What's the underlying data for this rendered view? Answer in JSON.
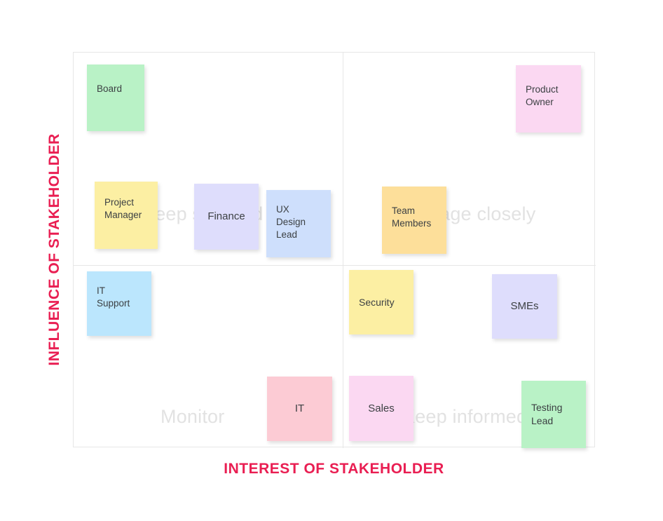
{
  "axes": {
    "y_title": "INFLUENCE OF STAKEHOLDER",
    "x_title": "INTEREST OF STAKEHOLDER",
    "axis_color": "#E91E52"
  },
  "matrix": {
    "frame_color": "#E6E6E6",
    "quadrants": [
      {
        "key": "keep_satisfied",
        "label": "Keep satisfied",
        "position": "top-left"
      },
      {
        "key": "manage_closely",
        "label": "Manage closely",
        "position": "top-right"
      },
      {
        "key": "monitor",
        "label": "Monitor",
        "position": "bottom-left"
      },
      {
        "key": "keep_informed",
        "label": "Keep informed",
        "position": "bottom-right"
      }
    ],
    "quadrant_label_color": "#E2E2E2"
  },
  "notes": [
    {
      "id": "board",
      "label": "Board",
      "color": "#B9F2C6",
      "quadrant": "keep_satisfied",
      "align": "left",
      "vertical": "top"
    },
    {
      "id": "project-manager",
      "label": "Project\nManager",
      "color": "#FCEFA3",
      "quadrant": "keep_satisfied",
      "align": "left",
      "vertical": "top"
    },
    {
      "id": "finance",
      "label": "Finance",
      "color": "#DEDDFC",
      "quadrant": "keep_satisfied",
      "align": "center",
      "vertical": "middle"
    },
    {
      "id": "ux-design-lead",
      "label": "UX\nDesign\nLead",
      "color": "#CEDFFC",
      "quadrant": "keep_satisfied",
      "align": "left",
      "vertical": "top"
    },
    {
      "id": "product-owner",
      "label": "Product\nOwner",
      "color": "#FBD8F2",
      "quadrant": "manage_closely",
      "align": "left",
      "vertical": "top"
    },
    {
      "id": "team-members",
      "label": "Team\nMembers",
      "color": "#FDDF9A",
      "quadrant": "manage_closely",
      "align": "left",
      "vertical": "top"
    },
    {
      "id": "it-support",
      "label": "IT\nSupport",
      "color": "#BBE6FD",
      "quadrant": "monitor",
      "align": "left",
      "vertical": "top"
    },
    {
      "id": "it",
      "label": "IT",
      "color": "#FCCBD4",
      "quadrant": "monitor",
      "align": "center",
      "vertical": "middle"
    },
    {
      "id": "security",
      "label": "Security",
      "color": "#FCEFA3",
      "quadrant": "keep_informed",
      "align": "left",
      "vertical": "middle"
    },
    {
      "id": "smes",
      "label": "SMEs",
      "color": "#DEDDFC",
      "quadrant": "keep_informed",
      "align": "center",
      "vertical": "middle"
    },
    {
      "id": "sales",
      "label": "Sales",
      "color": "#FBD8F2",
      "quadrant": "keep_informed",
      "align": "center",
      "vertical": "middle"
    },
    {
      "id": "testing-lead",
      "label": "Testing\nLead",
      "color": "#B9F2C6",
      "quadrant": "keep_informed",
      "align": "left",
      "vertical": "middle"
    }
  ]
}
